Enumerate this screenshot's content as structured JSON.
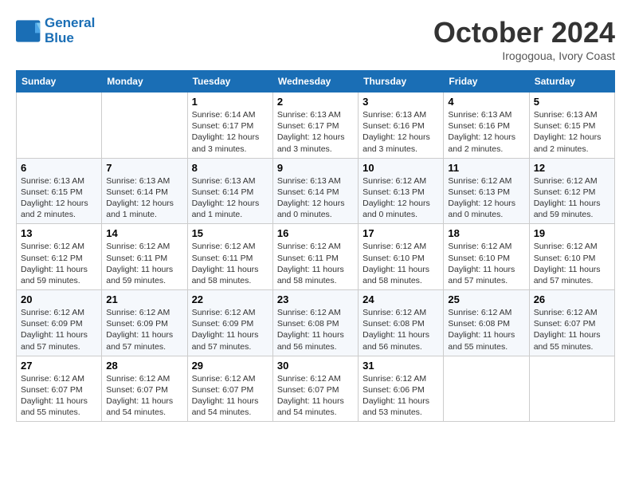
{
  "header": {
    "logo_line1": "General",
    "logo_line2": "Blue",
    "month": "October 2024",
    "location": "Irogogoua, Ivory Coast"
  },
  "weekdays": [
    "Sunday",
    "Monday",
    "Tuesday",
    "Wednesday",
    "Thursday",
    "Friday",
    "Saturday"
  ],
  "weeks": [
    [
      {
        "day": "",
        "sunrise": "",
        "sunset": "",
        "daylight": ""
      },
      {
        "day": "",
        "sunrise": "",
        "sunset": "",
        "daylight": ""
      },
      {
        "day": "1",
        "sunrise": "Sunrise: 6:14 AM",
        "sunset": "Sunset: 6:17 PM",
        "daylight": "Daylight: 12 hours and 3 minutes."
      },
      {
        "day": "2",
        "sunrise": "Sunrise: 6:13 AM",
        "sunset": "Sunset: 6:17 PM",
        "daylight": "Daylight: 12 hours and 3 minutes."
      },
      {
        "day": "3",
        "sunrise": "Sunrise: 6:13 AM",
        "sunset": "Sunset: 6:16 PM",
        "daylight": "Daylight: 12 hours and 3 minutes."
      },
      {
        "day": "4",
        "sunrise": "Sunrise: 6:13 AM",
        "sunset": "Sunset: 6:16 PM",
        "daylight": "Daylight: 12 hours and 2 minutes."
      },
      {
        "day": "5",
        "sunrise": "Sunrise: 6:13 AM",
        "sunset": "Sunset: 6:15 PM",
        "daylight": "Daylight: 12 hours and 2 minutes."
      }
    ],
    [
      {
        "day": "6",
        "sunrise": "Sunrise: 6:13 AM",
        "sunset": "Sunset: 6:15 PM",
        "daylight": "Daylight: 12 hours and 2 minutes."
      },
      {
        "day": "7",
        "sunrise": "Sunrise: 6:13 AM",
        "sunset": "Sunset: 6:14 PM",
        "daylight": "Daylight: 12 hours and 1 minute."
      },
      {
        "day": "8",
        "sunrise": "Sunrise: 6:13 AM",
        "sunset": "Sunset: 6:14 PM",
        "daylight": "Daylight: 12 hours and 1 minute."
      },
      {
        "day": "9",
        "sunrise": "Sunrise: 6:13 AM",
        "sunset": "Sunset: 6:14 PM",
        "daylight": "Daylight: 12 hours and 0 minutes."
      },
      {
        "day": "10",
        "sunrise": "Sunrise: 6:12 AM",
        "sunset": "Sunset: 6:13 PM",
        "daylight": "Daylight: 12 hours and 0 minutes."
      },
      {
        "day": "11",
        "sunrise": "Sunrise: 6:12 AM",
        "sunset": "Sunset: 6:13 PM",
        "daylight": "Daylight: 12 hours and 0 minutes."
      },
      {
        "day": "12",
        "sunrise": "Sunrise: 6:12 AM",
        "sunset": "Sunset: 6:12 PM",
        "daylight": "Daylight: 11 hours and 59 minutes."
      }
    ],
    [
      {
        "day": "13",
        "sunrise": "Sunrise: 6:12 AM",
        "sunset": "Sunset: 6:12 PM",
        "daylight": "Daylight: 11 hours and 59 minutes."
      },
      {
        "day": "14",
        "sunrise": "Sunrise: 6:12 AM",
        "sunset": "Sunset: 6:11 PM",
        "daylight": "Daylight: 11 hours and 59 minutes."
      },
      {
        "day": "15",
        "sunrise": "Sunrise: 6:12 AM",
        "sunset": "Sunset: 6:11 PM",
        "daylight": "Daylight: 11 hours and 58 minutes."
      },
      {
        "day": "16",
        "sunrise": "Sunrise: 6:12 AM",
        "sunset": "Sunset: 6:11 PM",
        "daylight": "Daylight: 11 hours and 58 minutes."
      },
      {
        "day": "17",
        "sunrise": "Sunrise: 6:12 AM",
        "sunset": "Sunset: 6:10 PM",
        "daylight": "Daylight: 11 hours and 58 minutes."
      },
      {
        "day": "18",
        "sunrise": "Sunrise: 6:12 AM",
        "sunset": "Sunset: 6:10 PM",
        "daylight": "Daylight: 11 hours and 57 minutes."
      },
      {
        "day": "19",
        "sunrise": "Sunrise: 6:12 AM",
        "sunset": "Sunset: 6:10 PM",
        "daylight": "Daylight: 11 hours and 57 minutes."
      }
    ],
    [
      {
        "day": "20",
        "sunrise": "Sunrise: 6:12 AM",
        "sunset": "Sunset: 6:09 PM",
        "daylight": "Daylight: 11 hours and 57 minutes."
      },
      {
        "day": "21",
        "sunrise": "Sunrise: 6:12 AM",
        "sunset": "Sunset: 6:09 PM",
        "daylight": "Daylight: 11 hours and 57 minutes."
      },
      {
        "day": "22",
        "sunrise": "Sunrise: 6:12 AM",
        "sunset": "Sunset: 6:09 PM",
        "daylight": "Daylight: 11 hours and 57 minutes."
      },
      {
        "day": "23",
        "sunrise": "Sunrise: 6:12 AM",
        "sunset": "Sunset: 6:08 PM",
        "daylight": "Daylight: 11 hours and 56 minutes."
      },
      {
        "day": "24",
        "sunrise": "Sunrise: 6:12 AM",
        "sunset": "Sunset: 6:08 PM",
        "daylight": "Daylight: 11 hours and 56 minutes."
      },
      {
        "day": "25",
        "sunrise": "Sunrise: 6:12 AM",
        "sunset": "Sunset: 6:08 PM",
        "daylight": "Daylight: 11 hours and 55 minutes."
      },
      {
        "day": "26",
        "sunrise": "Sunrise: 6:12 AM",
        "sunset": "Sunset: 6:07 PM",
        "daylight": "Daylight: 11 hours and 55 minutes."
      }
    ],
    [
      {
        "day": "27",
        "sunrise": "Sunrise: 6:12 AM",
        "sunset": "Sunset: 6:07 PM",
        "daylight": "Daylight: 11 hours and 55 minutes."
      },
      {
        "day": "28",
        "sunrise": "Sunrise: 6:12 AM",
        "sunset": "Sunset: 6:07 PM",
        "daylight": "Daylight: 11 hours and 54 minutes."
      },
      {
        "day": "29",
        "sunrise": "Sunrise: 6:12 AM",
        "sunset": "Sunset: 6:07 PM",
        "daylight": "Daylight: 11 hours and 54 minutes."
      },
      {
        "day": "30",
        "sunrise": "Sunrise: 6:12 AM",
        "sunset": "Sunset: 6:07 PM",
        "daylight": "Daylight: 11 hours and 54 minutes."
      },
      {
        "day": "31",
        "sunrise": "Sunrise: 6:12 AM",
        "sunset": "Sunset: 6:06 PM",
        "daylight": "Daylight: 11 hours and 53 minutes."
      },
      {
        "day": "",
        "sunrise": "",
        "sunset": "",
        "daylight": ""
      },
      {
        "day": "",
        "sunrise": "",
        "sunset": "",
        "daylight": ""
      }
    ]
  ]
}
